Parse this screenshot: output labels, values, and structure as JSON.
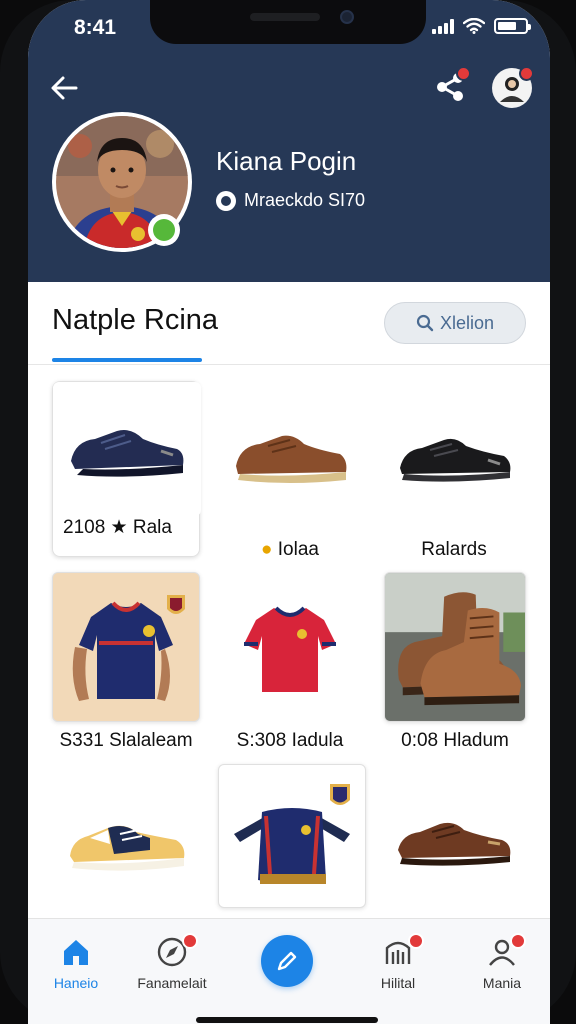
{
  "status_bar": {
    "time": "8:41"
  },
  "profile": {
    "name": "Kiana Pogin",
    "meta": "Mraeckdo SI70"
  },
  "section": {
    "title": "Natple Rcina",
    "search_label": "Xlelion"
  },
  "products": [
    {
      "caption": "2108 ★ Rala"
    },
    {
      "caption": "Iolaa"
    },
    {
      "caption": "Ralards"
    },
    {
      "caption": "S331 Slalaleam"
    },
    {
      "caption": "S:308 Iadula"
    },
    {
      "caption": "0:08 Hladum"
    },
    {
      "caption": ""
    },
    {
      "caption": ""
    },
    {
      "caption": ""
    }
  ],
  "bottom_nav": [
    {
      "label": "Haneio",
      "icon": "home-icon"
    },
    {
      "label": "Fanamelait",
      "icon": "compass-icon"
    },
    {
      "label": "",
      "icon": "pencil-icon"
    },
    {
      "label": "Hilital",
      "icon": "building-icon"
    },
    {
      "label": "Mania",
      "icon": "user-icon"
    }
  ],
  "colors": {
    "header": "#263856",
    "accent": "#1d84e6",
    "badge": "#e23a3a",
    "online": "#56b83a"
  }
}
